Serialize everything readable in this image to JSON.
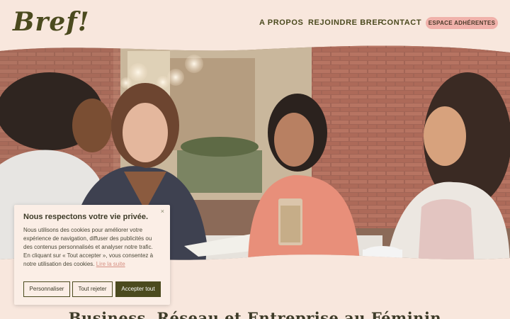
{
  "header": {
    "logo": "Bref!",
    "nav": {
      "a_propos": "A PROPOS",
      "rejoindre": "REJOINDRE BREF",
      "contact": "CONTACT"
    },
    "espace_button": "ESPACE ADHÉRENTES"
  },
  "hero": {
    "image_label": "hero-photo"
  },
  "cookie": {
    "close": "×",
    "title": "Nous respectons votre vie privée.",
    "text": "Nous utilisons des cookies pour améliorer votre expérience de navigation, diffuser des publicités ou des contenus personnalisés et analyser notre trafic. En cliquant sur « Tout accepter », vous consentez à notre utilisation des cookies.",
    "link": "Lire la suite",
    "buttons": {
      "personnaliser": "Personnaliser",
      "rejeter": "Tout rejeter",
      "accepter": "Accepter tout"
    }
  },
  "tagline": "Business, Réseau et Entreprise au Féminin",
  "colors": {
    "background": "#f8e7dd",
    "brand_olive": "#4b4a1e",
    "accent_pink": "#f0b1aa",
    "link_pink": "#d69083"
  }
}
